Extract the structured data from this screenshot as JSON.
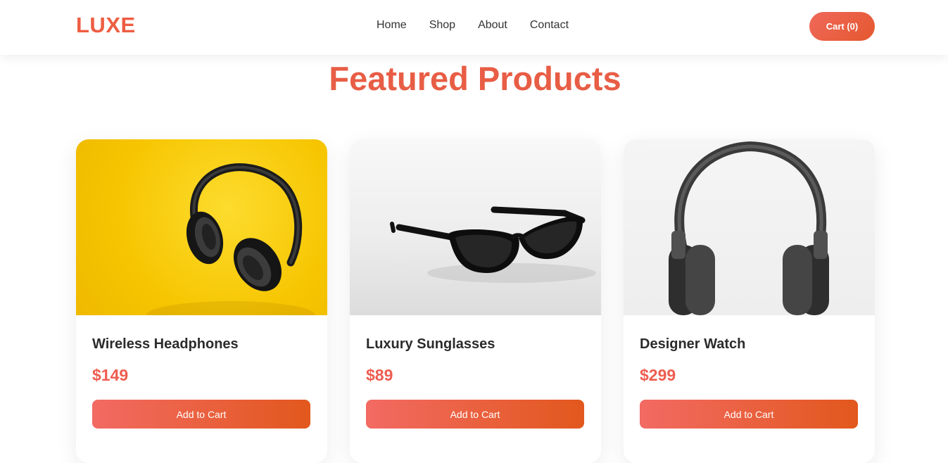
{
  "header": {
    "logo": "LUXE",
    "nav": [
      "Home",
      "Shop",
      "About",
      "Contact"
    ],
    "cart_label": "Cart (0)"
  },
  "main": {
    "title": "Featured Products",
    "products": [
      {
        "name": "Wireless Headphones",
        "price": "$149",
        "button": "Add to Cart",
        "image": "headphones-on-yellow"
      },
      {
        "name": "Luxury Sunglasses",
        "price": "$89",
        "button": "Add to Cart",
        "image": "sunglasses-on-white"
      },
      {
        "name": "Designer Watch",
        "price": "$299",
        "button": "Add to Cart",
        "image": "headphones-on-white"
      }
    ]
  },
  "colors": {
    "brand": "#ee5d42",
    "price": "#ee5d50",
    "button_start": "#f26a63",
    "button_end": "#e2581d"
  }
}
